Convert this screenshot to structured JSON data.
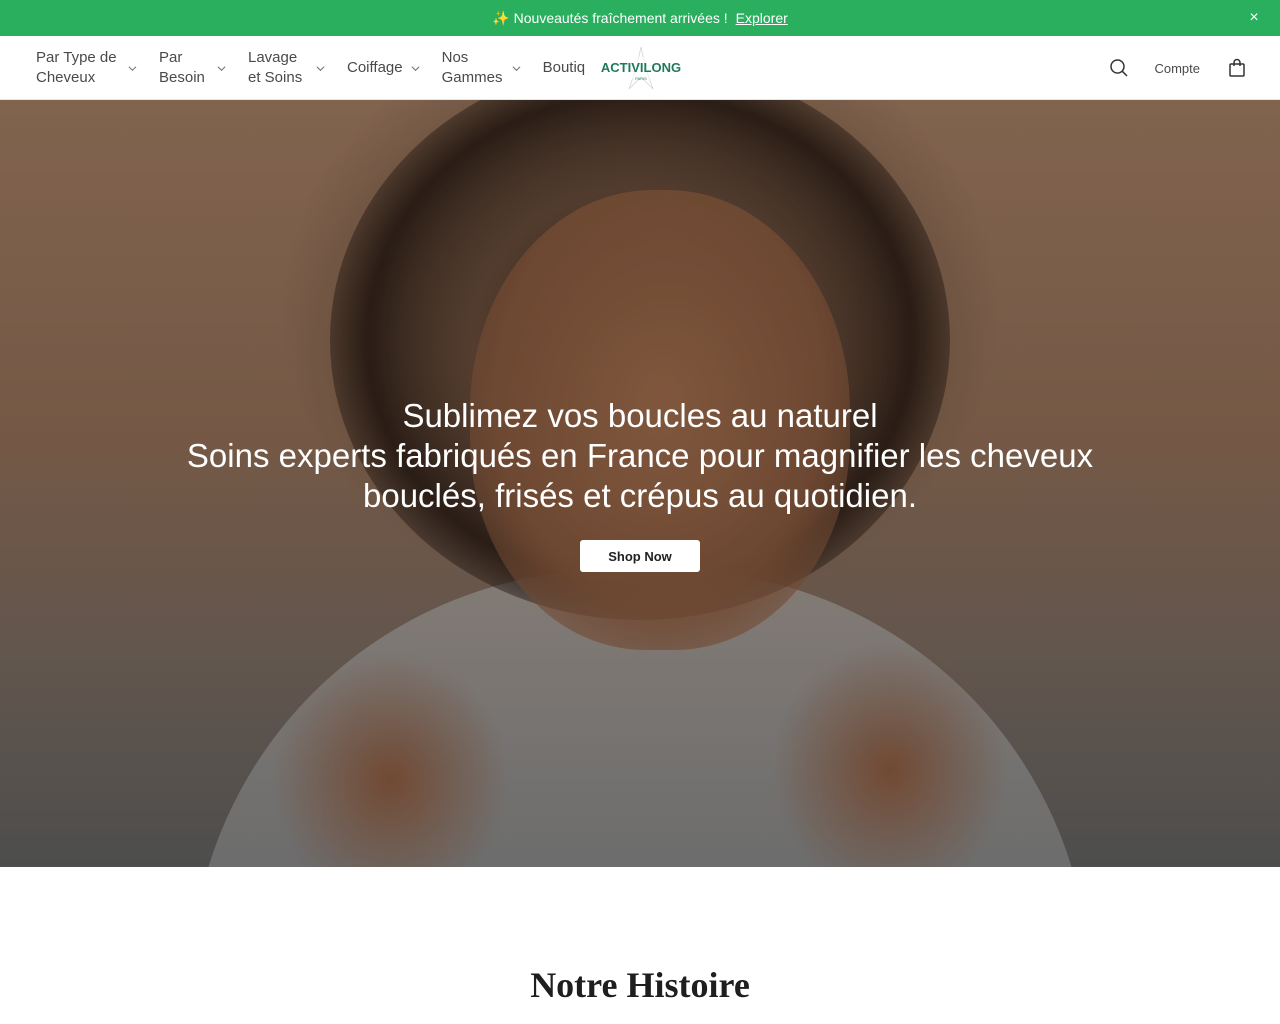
{
  "announcement": {
    "sparkle": "✨",
    "text": "Nouveautés fraîchement arrivées !",
    "link": "Explorer",
    "close": "×"
  },
  "nav": {
    "items": [
      {
        "label": "Par Type de Cheveux"
      },
      {
        "label": "Par Besoin"
      },
      {
        "label": "Lavage et Soins"
      },
      {
        "label": "Coiffage"
      },
      {
        "label": "Nos Gammes"
      },
      {
        "label": "Boutiq"
      }
    ]
  },
  "logo": {
    "brand": "ACTIVILONG",
    "sub": "PARIS"
  },
  "tools": {
    "account": "Compte"
  },
  "hero": {
    "title": "Sublimez vos boucles au naturel",
    "subtitle": "Soins experts fabriqués en France pour magnifier les cheveux bouclés, frisés et crépus au quotidien.",
    "cta": "Shop Now"
  },
  "story": {
    "title": "Notre Histoire"
  },
  "colors": {
    "announcement_bg": "#2aaf5f",
    "logo_green": "#1f7a5c"
  }
}
